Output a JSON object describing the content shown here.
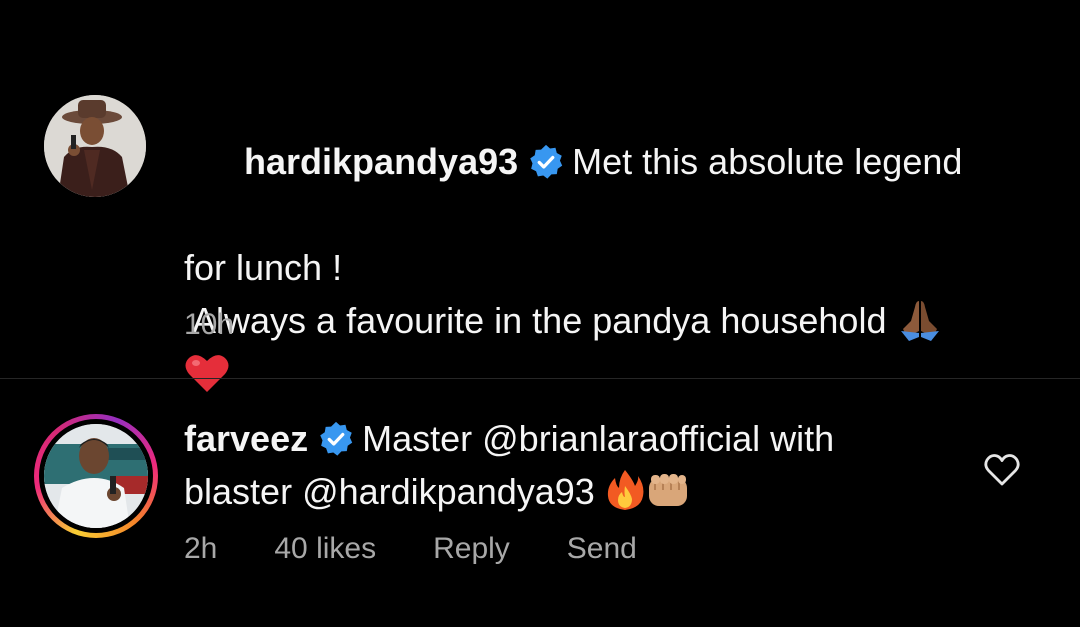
{
  "caption": {
    "username": "hardikpandya93",
    "text_line1": "Met this absolute legend",
    "text_line2": "for lunch !",
    "text_line3": " Always a favourite in the pandya household",
    "time": "10h",
    "emoji_pray": "pray-icon",
    "emoji_heart": "red-heart-icon"
  },
  "comment": {
    "username": "farveez",
    "text_prefix": "Master ",
    "mention1": "@brianlaraofficial",
    "text_mid": " with",
    "text_line2_prefix": "blaster ",
    "mention2": "@hardikpandya93",
    "time": "2h",
    "likes": "40 likes",
    "reply": "Reply",
    "send": "Send",
    "emoji_fire": "fire-icon",
    "emoji_fist": "fist-icon",
    "like_icon": "heart-outline-icon"
  },
  "colors": {
    "background": "#000000",
    "text": "#f5f5f5",
    "meta": "#a8a8a8",
    "verified": "#3897f0",
    "divider": "#262626"
  }
}
